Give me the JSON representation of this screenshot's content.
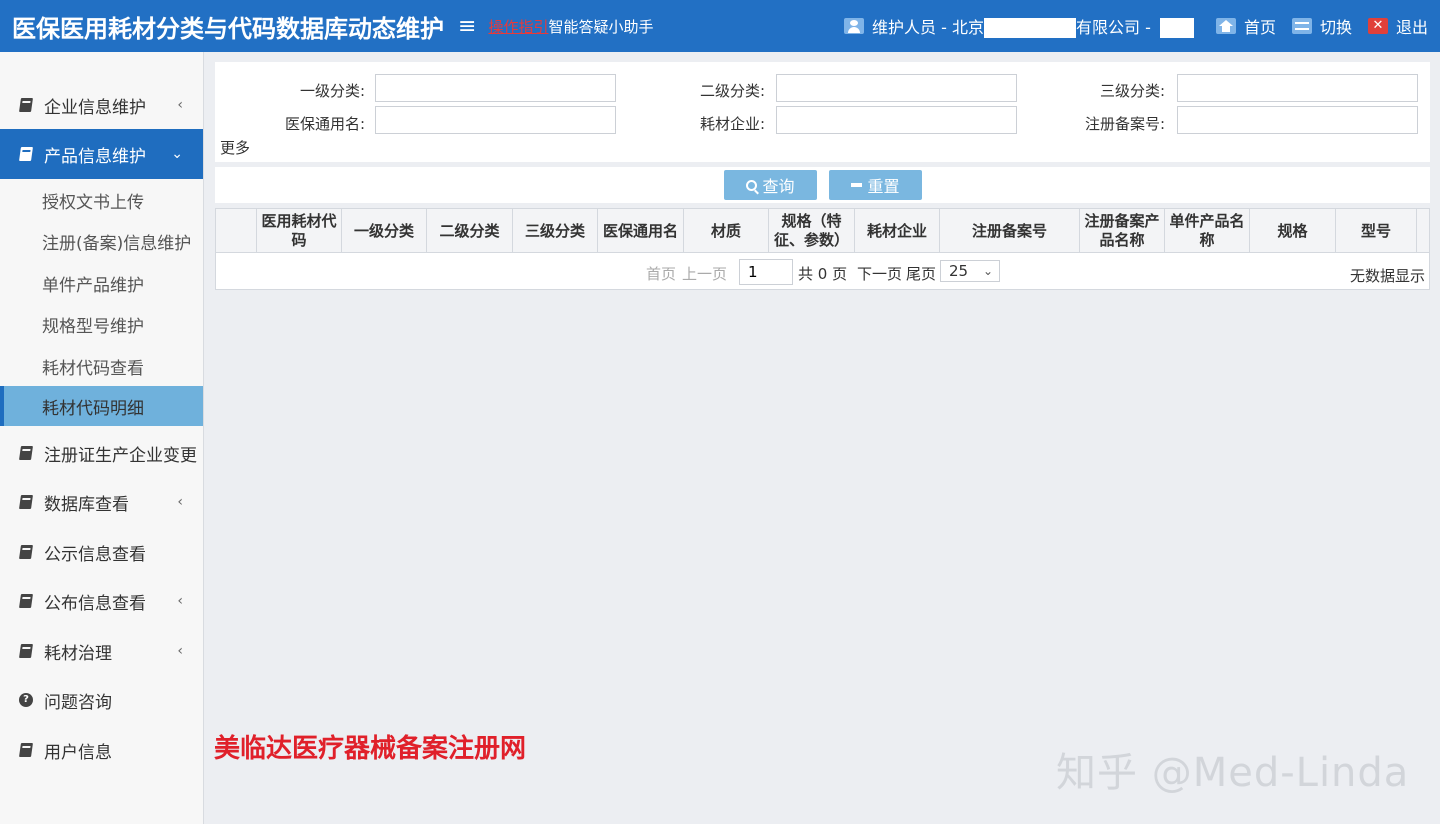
{
  "header": {
    "title": "医保医用耗材分类与代码数据库动态维护",
    "guide": "操作指引",
    "assistant": "智能答疑小助手",
    "maintainer_prefix": "维护人员 - 北京",
    "maintainer_suffix": "有限公司 -",
    "home": "首页",
    "switch": "切换",
    "logout": "退出"
  },
  "sidebar": {
    "items": [
      {
        "label": "企业信息维护",
        "icon": "book-icon",
        "chevron": "‹"
      },
      {
        "label": "产品信息维护",
        "icon": "book-icon",
        "chevron": "⌄"
      },
      {
        "label": "注册证生产企业变更",
        "icon": "book-icon"
      },
      {
        "label": "数据库查看",
        "icon": "book-icon",
        "chevron": "‹"
      },
      {
        "label": "公示信息查看",
        "icon": "book-icon"
      },
      {
        "label": "公布信息查看",
        "icon": "book-icon",
        "chevron": "‹"
      },
      {
        "label": "耗材治理",
        "icon": "book-icon",
        "chevron": "‹"
      },
      {
        "label": "问题咨询",
        "icon": "question-circle-icon"
      },
      {
        "label": "用户信息",
        "icon": "book-icon"
      }
    ],
    "subitems": [
      {
        "label": "授权文书上传"
      },
      {
        "label": "注册(备案)信息维护"
      },
      {
        "label": "单件产品维护"
      },
      {
        "label": "规格型号维护"
      },
      {
        "label": "耗材代码查看"
      },
      {
        "label": "耗材代码明细"
      }
    ]
  },
  "filters": {
    "level1": "一级分类:",
    "level2": "二级分类:",
    "level3": "三级分类:",
    "generic_name": "医保通用名:",
    "company": "耗材企业:",
    "reg_no": "注册备案号:",
    "more": "更多"
  },
  "buttons": {
    "query": "查询",
    "reset": "重置"
  },
  "table": {
    "columns": [
      "医用耗材代码",
      "一级分类",
      "二级分类",
      "三级分类",
      "医保通用名",
      "材质",
      "规格（特征、参数）",
      "耗材企业",
      "注册备案号",
      "注册备案产品名称",
      "单件产品名称",
      "规格",
      "型号"
    ]
  },
  "pager": {
    "first": "首页",
    "prev": "上一页",
    "page": "1",
    "total": "共 0 页",
    "next": "下一页",
    "last": "尾页",
    "size": "25",
    "empty": "无数据显示"
  },
  "watermarks": {
    "red": "美临达医疗器械备案注册网",
    "zhihu": "知乎 @Med-Linda"
  }
}
